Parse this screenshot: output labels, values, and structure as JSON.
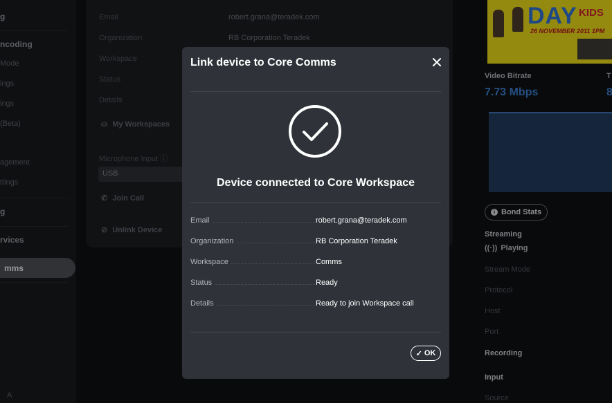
{
  "sidebar": {
    "items": [
      {
        "label": "g",
        "kind": "head"
      },
      {
        "label": "ncoding",
        "kind": "head"
      },
      {
        "label": "Mode",
        "kind": "item"
      },
      {
        "label": "ings",
        "kind": "item"
      },
      {
        "label": "ings",
        "kind": "item"
      },
      {
        "label": "(Beta)",
        "kind": "item"
      },
      {
        "label": "agement",
        "kind": "item"
      },
      {
        "label": "ttings",
        "kind": "item"
      },
      {
        "label": "g",
        "kind": "head"
      },
      {
        "label": "rvices",
        "kind": "head"
      },
      {
        "label": "A",
        "kind": "item"
      }
    ],
    "active_label": "mms"
  },
  "background_card": {
    "fields": [
      {
        "label": "Email",
        "value": "robert.grana@teradek.com"
      },
      {
        "label": "Organization",
        "value": "RB Corporation Teradek"
      },
      {
        "label": "Workspace",
        "value": ""
      },
      {
        "label": "Status",
        "value": ""
      },
      {
        "label": "Details",
        "value": ""
      }
    ],
    "my_workspaces": "My Workspaces",
    "mic_label": "Microphone Input",
    "mic_value": "USB",
    "join_call": "Join Call",
    "unlink_device": "Unlink Device"
  },
  "right_panel": {
    "thumb_text_main": "DAY",
    "thumb_text_kids": "KIDS",
    "thumb_text_date": "26 NOVEMBER 2011",
    "thumb_text_time": "1PM",
    "video_bitrate_label": "Video Bitrate",
    "video_bitrate_value": "7.73 Mbps",
    "col2_label": "T",
    "col2_value": "8",
    "bond_stats": "Bond Stats",
    "streaming": "Streaming",
    "playing": "Playing",
    "stream_mode": "Stream Mode",
    "protocol": "Protocol",
    "host": "Host",
    "port": "Port",
    "recording": "Recording",
    "input": "Input",
    "source": "Source"
  },
  "modal": {
    "title": "Link device to Core Comms",
    "heading": "Device connected to Core Workspace",
    "fields": [
      {
        "label": "Email",
        "value": "robert.grana@teradek.com"
      },
      {
        "label": "Organization",
        "value": "RB Corporation Teradek"
      },
      {
        "label": "Workspace",
        "value": "Comms"
      },
      {
        "label": "Status",
        "value": "Ready"
      },
      {
        "label": "Details",
        "value": "Ready to join Workspace call"
      }
    ],
    "ok_label": "OK"
  },
  "colors": {
    "modal_bg": "#2f3339",
    "accent_blue": "#3a78c7",
    "page_bg": "#0e1013"
  }
}
